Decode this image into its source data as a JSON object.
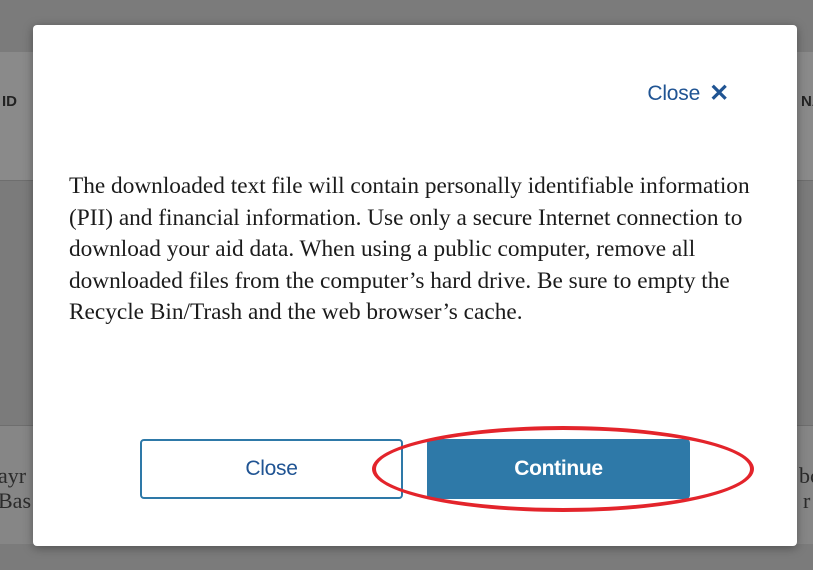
{
  "background": {
    "left_header_fragment": "ID",
    "right_header_fragment": "NA",
    "left_row_fragment_line1": "ayr",
    "left_row_fragment_line2": "Bas",
    "right_row_fragment_line1": "bc",
    "right_row_fragment_line2": "r"
  },
  "modal": {
    "close_link_label": "Close",
    "close_icon_glyph": "✕",
    "message": "The downloaded text file will contain personally identifiable information (PII) and financial information. Use only a secure Internet connection to download your aid data. When using a public computer, remove all downloaded files from the computer’s hard drive. Be sure to empty the Recycle Bin/Trash and the web browser’s cache.",
    "close_button_label": "Close",
    "continue_button_label": "Continue"
  },
  "colors": {
    "primary": "#2e79a8",
    "link": "#205493",
    "annotation": "#e3242b",
    "overlay": "#7b7b7b"
  }
}
